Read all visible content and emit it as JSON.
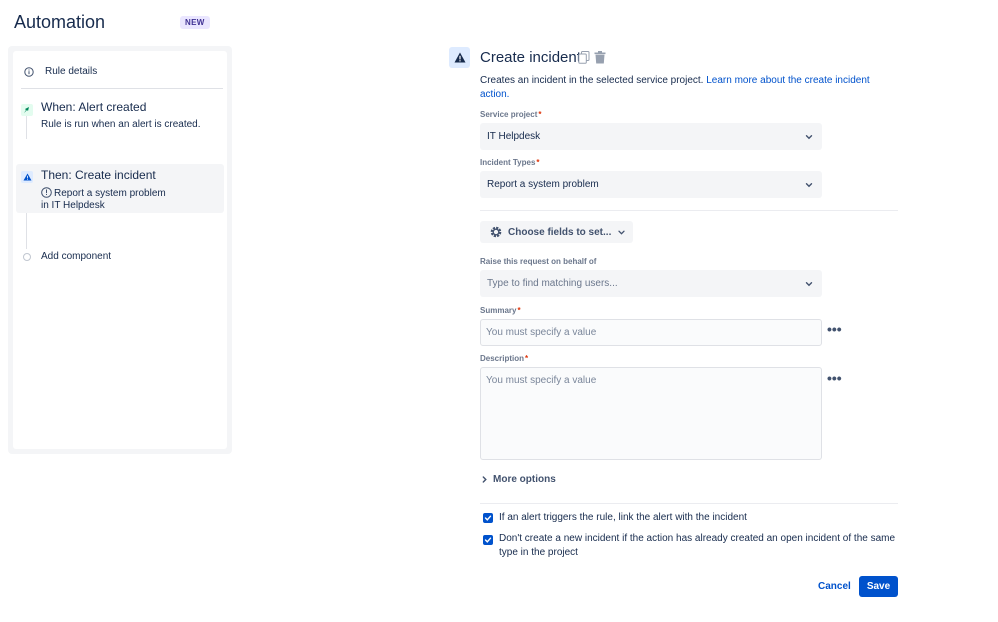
{
  "header": {
    "title": "Automation",
    "badge": "NEW"
  },
  "sidebar": {
    "rule_details": "Rule details",
    "trigger": {
      "title": "When: Alert created",
      "description": "Rule is run when an alert is created."
    },
    "action": {
      "title": "Then: Create incident",
      "description_line1": "Report a system problem",
      "description_line2": "in IT Helpdesk"
    },
    "add_component": "Add component"
  },
  "panel": {
    "title": "Create incident",
    "description_text": "Creates an incident in the selected service project. ",
    "description_link": "Learn more about the create incident action.",
    "service_project": {
      "label": "Service project",
      "value": "IT Helpdesk"
    },
    "incident_types": {
      "label": "Incident Types",
      "value": "Report a system problem"
    },
    "choose_fields": "Choose fields to set...",
    "behalf": {
      "label": "Raise this request on behalf of",
      "placeholder": "Type to find matching users..."
    },
    "summary": {
      "label": "Summary",
      "placeholder": "You must specify a value"
    },
    "description": {
      "label": "Description",
      "placeholder": "You must specify a value"
    },
    "more_options": "More options",
    "checkbox1": "If an alert triggers the rule, link the alert with the incident",
    "checkbox2": "Don't create a new incident if the action has already created an open incident of the same type in the project",
    "cancel": "Cancel",
    "save": "Save",
    "required_mark": "*",
    "more_dots": "•••"
  },
  "colors": {
    "primary": "#0052cc",
    "required": "#de350b",
    "trigger_green": "#00875a"
  },
  "icons": [
    "info-icon",
    "alert-leaf-icon",
    "warning-triangle-icon",
    "copy-icon",
    "trash-icon",
    "gear-icon",
    "chevron-down-icon",
    "chevron-right-icon",
    "checkmark-icon"
  ]
}
